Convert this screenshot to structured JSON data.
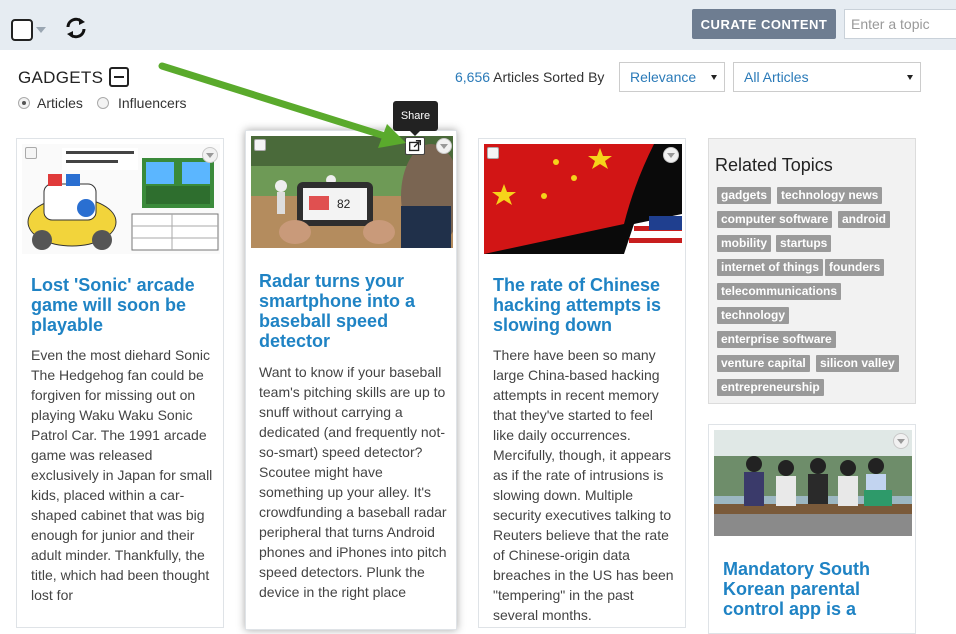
{
  "toolbar": {
    "curate_label": "CURATE CONTENT",
    "topic_placeholder": "Enter a topic"
  },
  "page": {
    "title": "GADGETS",
    "radio_articles": "Articles",
    "radio_influencers": "Influencers",
    "selected_radio": "Articles"
  },
  "sort": {
    "count": "6,656",
    "count_suffix": "Articles Sorted By",
    "sort_value": "Relevance",
    "filter_value": "All Articles"
  },
  "tooltip": {
    "share": "Share"
  },
  "cards": [
    {
      "title": "Lost 'Sonic' arcade game will soon be playable",
      "body": "Even the most diehard Sonic The Hedgehog fan could be forgiven for missing out on playing Waku Waku Sonic Patrol Car. The 1991 arcade game was released exclusively in Japan for small kids, placed within a car-shaped cabinet that was big enough for junior and their adult minder. Thankfully, the title, which had been thought lost for"
    },
    {
      "title": "Radar turns your smartphone into a baseball speed detector",
      "body": "Want to know if your baseball team's pitching skills are up to snuff without carrying a dedicated (and frequently not-so-smart) speed detector? Scoutee might have something up your alley. It's crowdfunding a baseball radar peripheral that turns Android phones and iPhones into pitch speed detectors. Plunk the device in the right place"
    },
    {
      "title": "The rate of Chinese hacking attempts is slowing down",
      "body": "There have been so many large China-based hacking attempts in recent memory that they've started to feel like daily occurrences. Mercifully, though, it appears as if the rate of intrusions is slowing down. Multiple security executives talking to Reuters believe that the rate of Chinese-origin data breaches in the US has been \"tempering\" in the past several months."
    },
    {
      "title": "Mandatory South Korean parental control app is a",
      "body": ""
    }
  ],
  "related": {
    "heading": "Related Topics",
    "tags": [
      "gadgets",
      "technology news",
      "computer software",
      "android",
      "mobility",
      "startups",
      "internet of things",
      "founders",
      "telecommunications",
      "technology",
      "enterprise software",
      "venture capital",
      "silicon valley",
      "entrepreneurship"
    ]
  },
  "colors": {
    "accent": "#1f83c4",
    "arrow": "#5aaa2c",
    "topbar": "#e6ecf2",
    "curate_button": "#6e7d91",
    "tag": "#9a9a9a"
  }
}
